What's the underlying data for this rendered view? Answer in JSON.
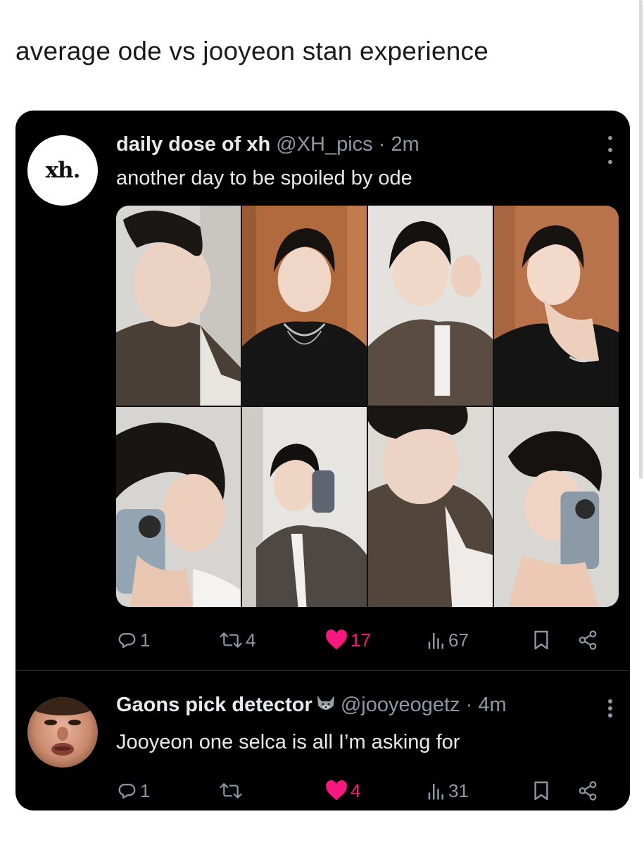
{
  "caption": "average ode vs jooyeon stan experience",
  "tweets": [
    {
      "avatar_text": "xh.",
      "name": "daily dose of xh",
      "handle": "@XH_pics",
      "separator": "·",
      "time": "2m",
      "text": "another day to be spoiled by ode",
      "photo_count": 8,
      "replies": "1",
      "retweets": "4",
      "likes": "17",
      "views": "67",
      "liked": true
    },
    {
      "name": "Gaons pick detector",
      "name_emoji": "wolf-emoji",
      "handle": "@jooyeogetz",
      "separator": "·",
      "time": "4m",
      "text": "Jooyeon one selca is all I’m asking for",
      "replies": "1",
      "retweets": "",
      "likes": "4",
      "views": "31",
      "liked": true
    }
  ],
  "colors": {
    "card_bg": "#000000",
    "text": "#e7e9ea",
    "muted": "#8b98a5",
    "like": "#f91880",
    "divider": "#2f3336"
  },
  "icons": [
    "reply-icon",
    "retweet-icon",
    "heart-icon",
    "views-icon",
    "bookmark-icon",
    "share-icon",
    "more-icon"
  ]
}
